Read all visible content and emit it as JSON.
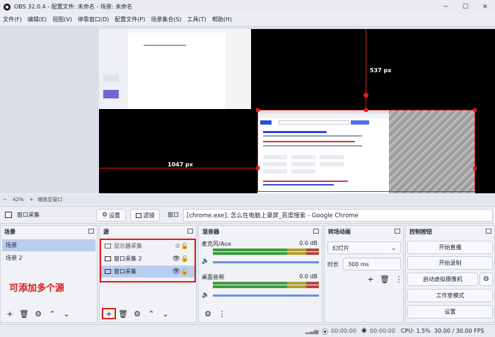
{
  "window": {
    "title": "OBS 32.0.4 - 配置文件: 未命名 - 场景: 未命名",
    "minimize": "─",
    "maximize": "☐",
    "close": "✕"
  },
  "menu": [
    "文件(F)",
    "编辑(E)",
    "视图(V)",
    "停靠窗口(D)",
    "配置文件(P)",
    "场景集合(S)",
    "工具(T)",
    "帮助(H)"
  ],
  "preview": {
    "dim_top": "537 px",
    "dim_left": "1047 px"
  },
  "zoombar": {
    "minus": "−",
    "zoom": "42%",
    "plus": "+",
    "fit": "缩放至窗口"
  },
  "sourcebar": {
    "source_name": "窗口采集",
    "settings_label": "设置",
    "filters_label": "滤镜",
    "window_label": "窗口",
    "window_value": "[chrome.exe]: 怎么在电脑上录屏_百度搜索 - Google Chrome"
  },
  "scenes": {
    "title": "场景",
    "items": [
      "场景",
      "场景 2"
    ],
    "annotation": "可添加多个源"
  },
  "sources": {
    "title": "源",
    "items": [
      "显示器采集",
      "窗口采集 2",
      "窗口采集"
    ]
  },
  "mixer": {
    "title": "混音器",
    "channels": [
      {
        "name": "麦克风/Aux",
        "db": "0.0 dB"
      },
      {
        "name": "桌面音频",
        "db": "0.0 dB"
      }
    ],
    "scale": [
      "-60",
      "-55",
      "-50",
      "-45",
      "-40",
      "-35",
      "-30",
      "-25",
      "-20",
      "-15",
      "-10",
      "-5",
      "0"
    ]
  },
  "transitions": {
    "title": "转场动画",
    "type": "幻灯片",
    "duration_label": "时长",
    "duration_value": "300 ms"
  },
  "controls": {
    "title": "控制按钮",
    "start_stream": "开始直播",
    "start_record": "开始录制",
    "virtual_cam": "启动虚拟摄像机",
    "studio_mode": "工作室模式",
    "settings": "设置"
  },
  "status": {
    "stream_time": "00:00:00",
    "record_time": "00:00:00",
    "cpu": "CPU: 1.5%",
    "fps": "30.00 / 30.00 FPS"
  },
  "colors": {
    "accent_red": "#e01b1b",
    "selection": "#b9cdee"
  }
}
